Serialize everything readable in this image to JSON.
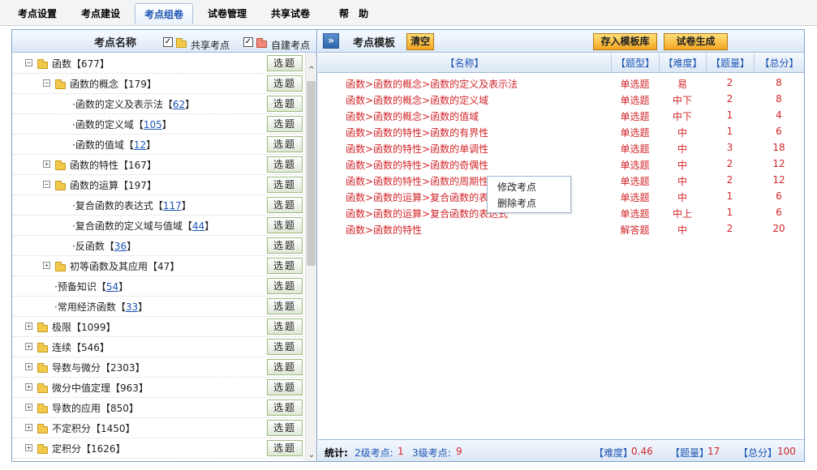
{
  "tabs": [
    {
      "label": "考点设置",
      "active": false
    },
    {
      "label": "考点建设",
      "active": false
    },
    {
      "label": "考点组卷",
      "active": true
    },
    {
      "label": "试卷管理",
      "active": false
    },
    {
      "label": "共享试卷",
      "active": false
    },
    {
      "label": "帮　助",
      "active": false
    }
  ],
  "left": {
    "title": "考点名称",
    "shared_label": "共享考点",
    "own_label": "自建考点",
    "check_mark": "✓",
    "select_label": "选题",
    "expanded_glyph": "−",
    "collapsed_glyph": "+",
    "tree": [
      {
        "level": 0,
        "exp": "-",
        "folder": true,
        "name": "函数",
        "count": "677",
        "link": false
      },
      {
        "level": 1,
        "exp": "-",
        "folder": true,
        "name": "函数的概念",
        "count": "179",
        "link": false
      },
      {
        "level": 2,
        "exp": "",
        "folder": false,
        "name": "·函数的定义及表示法",
        "count": "62",
        "link": true
      },
      {
        "level": 2,
        "exp": "",
        "folder": false,
        "name": "·函数的定义域",
        "count": "105",
        "link": true
      },
      {
        "level": 2,
        "exp": "",
        "folder": false,
        "name": "·函数的值域",
        "count": "12",
        "link": true
      },
      {
        "level": 1,
        "exp": "+",
        "folder": true,
        "name": "函数的特性",
        "count": "167",
        "link": false
      },
      {
        "level": 1,
        "exp": "-",
        "folder": true,
        "name": "函数的运算",
        "count": "197",
        "link": false
      },
      {
        "level": 2,
        "exp": "",
        "folder": false,
        "name": "·复合函数的表达式",
        "count": "117",
        "link": true
      },
      {
        "level": 2,
        "exp": "",
        "folder": false,
        "name": "·复合函数的定义域与值域",
        "count": "44",
        "link": true
      },
      {
        "level": 2,
        "exp": "",
        "folder": false,
        "name": "·反函数",
        "count": "36",
        "link": true
      },
      {
        "level": 1,
        "exp": "+",
        "folder": true,
        "name": "初等函数及其应用",
        "count": "47",
        "link": false
      },
      {
        "level": 1.5,
        "exp": "",
        "folder": false,
        "name": "·预备知识",
        "count": "54",
        "link": true
      },
      {
        "level": 1.5,
        "exp": "",
        "folder": false,
        "name": "·常用经济函数",
        "count": "33",
        "link": true
      },
      {
        "level": 0,
        "exp": "+",
        "folder": true,
        "name": "极限",
        "count": "1099",
        "link": false
      },
      {
        "level": 0,
        "exp": "+",
        "folder": true,
        "name": "连续",
        "count": "546",
        "link": false
      },
      {
        "level": 0,
        "exp": "+",
        "folder": true,
        "name": "导数与微分",
        "count": "2303",
        "link": false
      },
      {
        "level": 0,
        "exp": "+",
        "folder": true,
        "name": "微分中值定理",
        "count": "963",
        "link": false
      },
      {
        "level": 0,
        "exp": "+",
        "folder": true,
        "name": "导数的应用",
        "count": "850",
        "link": false
      },
      {
        "level": 0,
        "exp": "+",
        "folder": true,
        "name": "不定积分",
        "count": "1450",
        "link": false
      },
      {
        "level": 0,
        "exp": "+",
        "folder": true,
        "name": "定积分",
        "count": "1626",
        "link": false
      }
    ],
    "scroll_up": "^",
    "scroll_down": "⌄"
  },
  "right": {
    "expand_glyph": "»",
    "title": "考点模板",
    "clear_label": "清空",
    "save_template_label": "存入模板库",
    "generate_label": "试卷生成",
    "columns": [
      "【名称】",
      "【题型】",
      "【难度】",
      "【题量】",
      "【总分】"
    ],
    "rows": [
      {
        "name": "函数>函数的概念>函数的定义及表示法",
        "type": "单选题",
        "difficulty": "易",
        "qty": "2",
        "score": "8"
      },
      {
        "name": "函数>函数的概念>函数的定义域",
        "type": "单选题",
        "difficulty": "中下",
        "qty": "2",
        "score": "8"
      },
      {
        "name": "函数>函数的概念>函数的值域",
        "type": "单选题",
        "difficulty": "中下",
        "qty": "1",
        "score": "4"
      },
      {
        "name": "函数>函数的特性>函数的有界性",
        "type": "单选题",
        "difficulty": "中",
        "qty": "1",
        "score": "6"
      },
      {
        "name": "函数>函数的特性>函数的单调性",
        "type": "单选题",
        "difficulty": "中",
        "qty": "3",
        "score": "18"
      },
      {
        "name": "函数>函数的特性>函数的奇偶性",
        "type": "单选题",
        "difficulty": "中",
        "qty": "2",
        "score": "12"
      },
      {
        "name": "函数>函数的特性>函数的周期性",
        "type": "单选题",
        "difficulty": "中",
        "qty": "2",
        "score": "12"
      },
      {
        "name": "函数>函数的运算>复合函数的表达式",
        "type": "单选题",
        "difficulty": "中",
        "qty": "1",
        "score": "6"
      },
      {
        "name": "函数>函数的运算>复合函数的表达式",
        "type": "单选题",
        "difficulty": "中上",
        "qty": "1",
        "score": "6"
      },
      {
        "name": "函数>函数的特性",
        "type": "解答题",
        "difficulty": "中",
        "qty": "2",
        "score": "20"
      }
    ],
    "context_menu": [
      "修改考点",
      "删除考点"
    ],
    "footer": {
      "stats_label": "统计:",
      "level2_label": "2级考点:",
      "level2_value": "1",
      "level3_label": "3级考点:",
      "level3_value": "9",
      "difficulty_label": "【难度】",
      "difficulty_value": "0.46",
      "qty_label": "【题量】",
      "qty_value": "17",
      "score_label": "【总分】",
      "score_value": "100"
    }
  },
  "colors": {
    "accent": "#1d55b5",
    "data_red": "#d3262a",
    "orange_button": "#f3a521",
    "border_blue": "#7ea3c9"
  }
}
